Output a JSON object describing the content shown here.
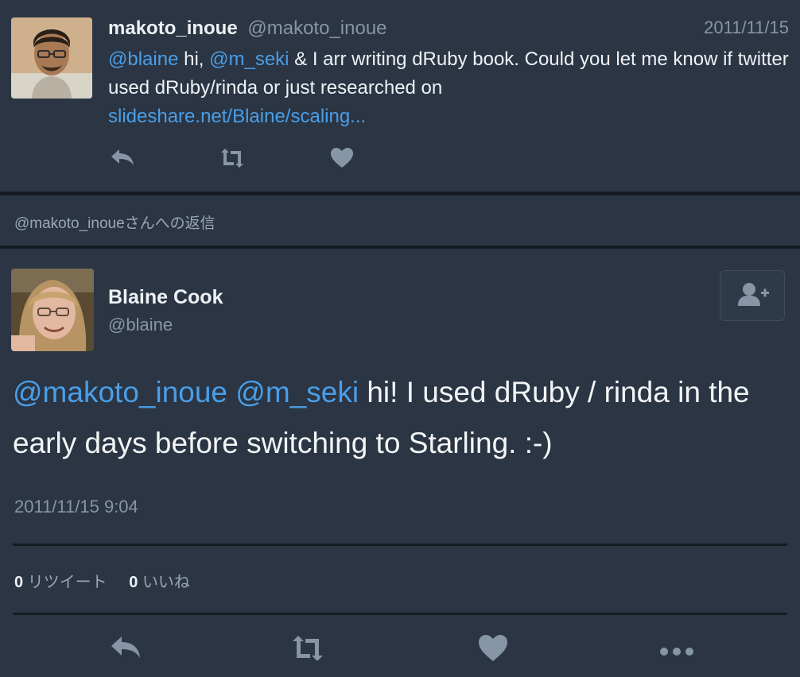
{
  "parent_tweet": {
    "name": "makoto_inoue",
    "handle": "@makoto_inoue",
    "date": "2011/11/15",
    "body": {
      "mention1": "@blaine",
      "text1": " hi, ",
      "mention2": "@m_seki",
      "text2": " & I arr writing dRuby book. Could you let me know if twitter used dRuby/rinda or just researched on ",
      "link": "slideshare.net/Blaine/scaling..."
    },
    "actions": [
      "reply-icon",
      "retweet-icon",
      "like-icon"
    ]
  },
  "reply_context": {
    "text": "@makoto_inoueさんへの返信"
  },
  "main_tweet": {
    "name": "Blaine Cook",
    "handle": "@blaine",
    "follow_icon": "add-user-icon",
    "body": {
      "mention1": "@makoto_inoue",
      "mention2": "@m_seki",
      "text": " hi! I used dRuby / rinda in the early days before switching to Starling. :-)"
    },
    "timestamp": "2011/11/15 9:04",
    "stats": {
      "retweets_count": "0",
      "retweets_label": "リツイート",
      "likes_count": "0",
      "likes_label": "いいね"
    },
    "actions": [
      "reply-icon",
      "retweet-icon",
      "like-icon",
      "more-icon"
    ]
  },
  "colors": {
    "background": "#2b3543",
    "link": "#4a9ee8",
    "muted": "#8796a6",
    "divider": "#151b22"
  }
}
